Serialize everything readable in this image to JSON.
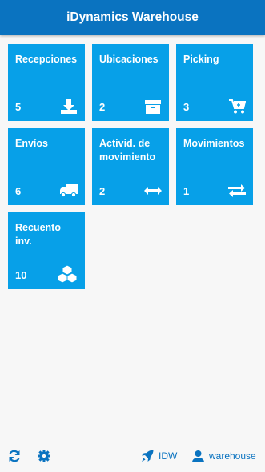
{
  "header": {
    "title": "iDynamics Warehouse"
  },
  "tiles": [
    {
      "label": "Recepciones",
      "count": "5",
      "icon": "download-tray-icon"
    },
    {
      "label": "Ubicaciones",
      "count": "2",
      "icon": "archive-box-icon"
    },
    {
      "label": "Picking",
      "count": "3",
      "icon": "cart-icon"
    },
    {
      "label": "Envíos",
      "count": "6",
      "icon": "truck-icon"
    },
    {
      "label": "Activid. de movimiento",
      "count": "2",
      "icon": "left-right-arrow-icon"
    },
    {
      "label": "Movimientos",
      "count": "1",
      "icon": "exchange-arrows-icon"
    },
    {
      "label": "Recuento inv.",
      "count": "10",
      "icon": "cubes-icon"
    }
  ],
  "footer": {
    "app_label": "IDW",
    "user_label": "warehouse",
    "icons": [
      "refresh-icon",
      "gear-icon",
      "rocket-icon",
      "user-icon"
    ]
  },
  "colors": {
    "header": "#0a73c0",
    "tile": "#07a0e8",
    "background": "#f7f7f7",
    "footer_text": "#0a73c0"
  }
}
